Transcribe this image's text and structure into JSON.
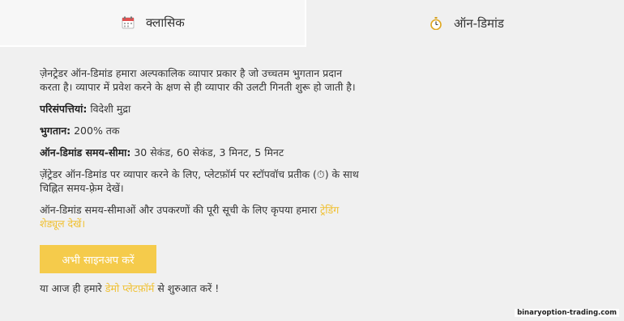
{
  "tabs": {
    "classic": {
      "label": "क्लासिक",
      "icon": "calendar-icon"
    },
    "on_demand": {
      "label": "ऑन-डिमांड",
      "icon": "stopwatch-icon"
    }
  },
  "content": {
    "intro": "ज़ेनट्रेडर ऑन-डिमांड हमारा अल्पकालिक व्यापार प्रकार है जो उच्चतम भुगतान प्रदान करता है। व्यापार में प्रवेश करने के क्षण से ही व्यापार की उलटी गिनती शुरू हो जाती है।",
    "assets_label": "परिसंपत्तियां:",
    "assets_value": " विदेशी मुद्रा",
    "payout_label": "भुगतान:",
    "payout_value": " 200% तक",
    "timeframe_label": "ऑन-डिमांड समय-सीमा:",
    "timeframe_value": " 30 सेकंड, 60 सेकंड, 3 मिनट, 5 मिनट",
    "stopwatch_note_before": "ज़ेंट्रेडर ऑन-डिमांड पर व्यापार करने के लिए, प्लेटफ़ॉर्म पर स्टॉपवॉच प्रतीक (",
    "stopwatch_symbol": "⏱",
    "stopwatch_note_after": ") के साथ चिह्नित समय-फ़्रेम देखें।",
    "schedule_text": "ऑन-डिमांड समय-सीमाओं और उपकरणों की पूरी सूची के लिए कृपया हमारा ",
    "schedule_link": "ट्रेडिंग शेड्यूल देखें।"
  },
  "cta": {
    "label": "अभी साइनअप करें"
  },
  "demo": {
    "before": "या आज ही हमारे ",
    "link": "डेमो प्लेटफ़ॉर्म",
    "after": " से शुरुआत करें !"
  },
  "watermark": "binaryoption-trading.com",
  "colors": {
    "accent": "#f5cb4b",
    "link": "#f0c030",
    "background": "#f0f0f0"
  }
}
